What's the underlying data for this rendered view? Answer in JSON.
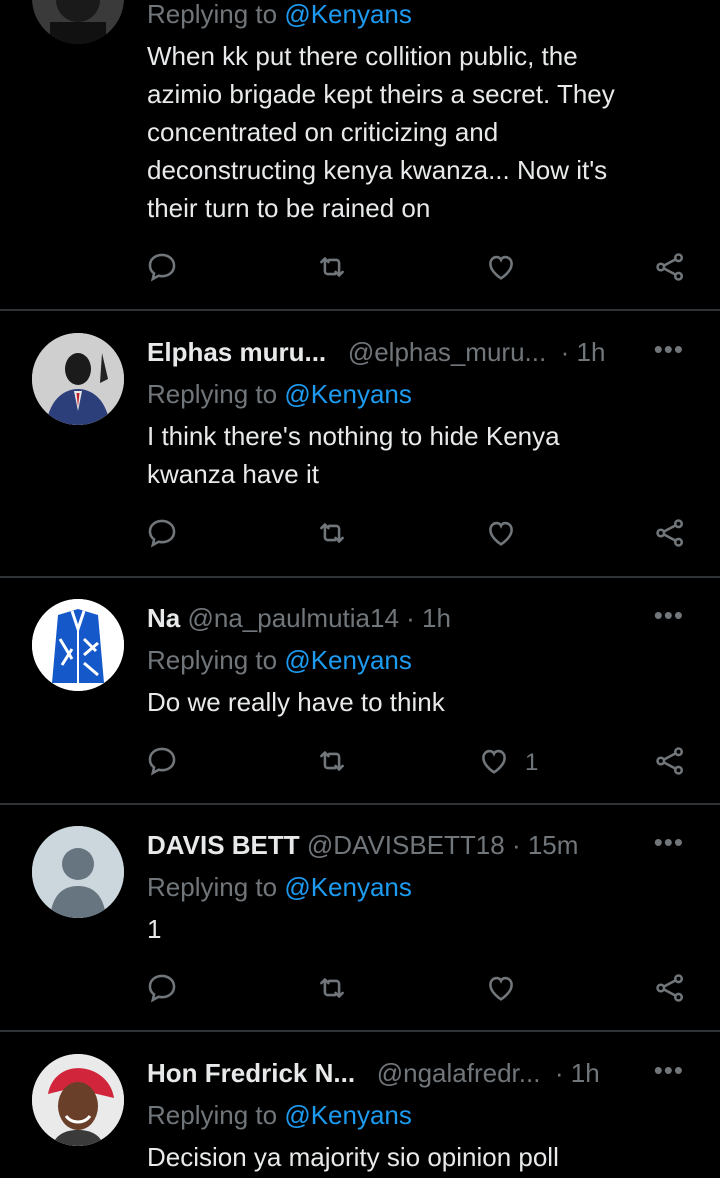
{
  "tweets": [
    {
      "name": "",
      "handle": "",
      "time": "",
      "replying_prefix": "Replying to ",
      "replying_to": "@Kenyans",
      "text_lines": [
        "When kk put there collition public, the",
        "azimio brigade kept theirs a secret. They",
        "concentrated on criticizing and",
        "deconstructing kenya kwanza... Now it's",
        "their turn to be rained on"
      ],
      "likes": ""
    },
    {
      "name": "Elphas muru...",
      "handle": "@elphas_muru...",
      "time": "· 1h",
      "replying_prefix": "Replying to ",
      "replying_to": "@Kenyans",
      "text_lines": [
        "I think there's nothing to hide Kenya",
        "kwanza have it"
      ],
      "likes": ""
    },
    {
      "name": "Na",
      "handle": "@na_paulmutia14",
      "time": "· 1h",
      "replying_prefix": "Replying to ",
      "replying_to": "@Kenyans",
      "text_lines": [
        "Do we really have to think"
      ],
      "likes": "1"
    },
    {
      "name": "DAVIS BETT",
      "handle": "@DAVISBETT18",
      "time": "· 15m",
      "replying_prefix": "Replying to ",
      "replying_to": "@Kenyans",
      "text_lines": [
        "1"
      ],
      "likes": ""
    },
    {
      "name": "Hon Fredrick N...",
      "handle": "@ngalafredr...",
      "time": "· 1h",
      "replying_prefix": "Replying to ",
      "replying_to": "@Kenyans",
      "text_lines": [
        "Decision ya majority sio opinion poll"
      ],
      "likes": ""
    }
  ],
  "more_glyph": "•••",
  "colors": {
    "background": "#000000",
    "text": "#e7e9ea",
    "muted": "#71767b",
    "accent": "#1d9bf0",
    "divider": "#2f3336"
  },
  "icons": [
    "reply-icon",
    "retweet-icon",
    "like-icon",
    "share-icon",
    "more-icon"
  ]
}
